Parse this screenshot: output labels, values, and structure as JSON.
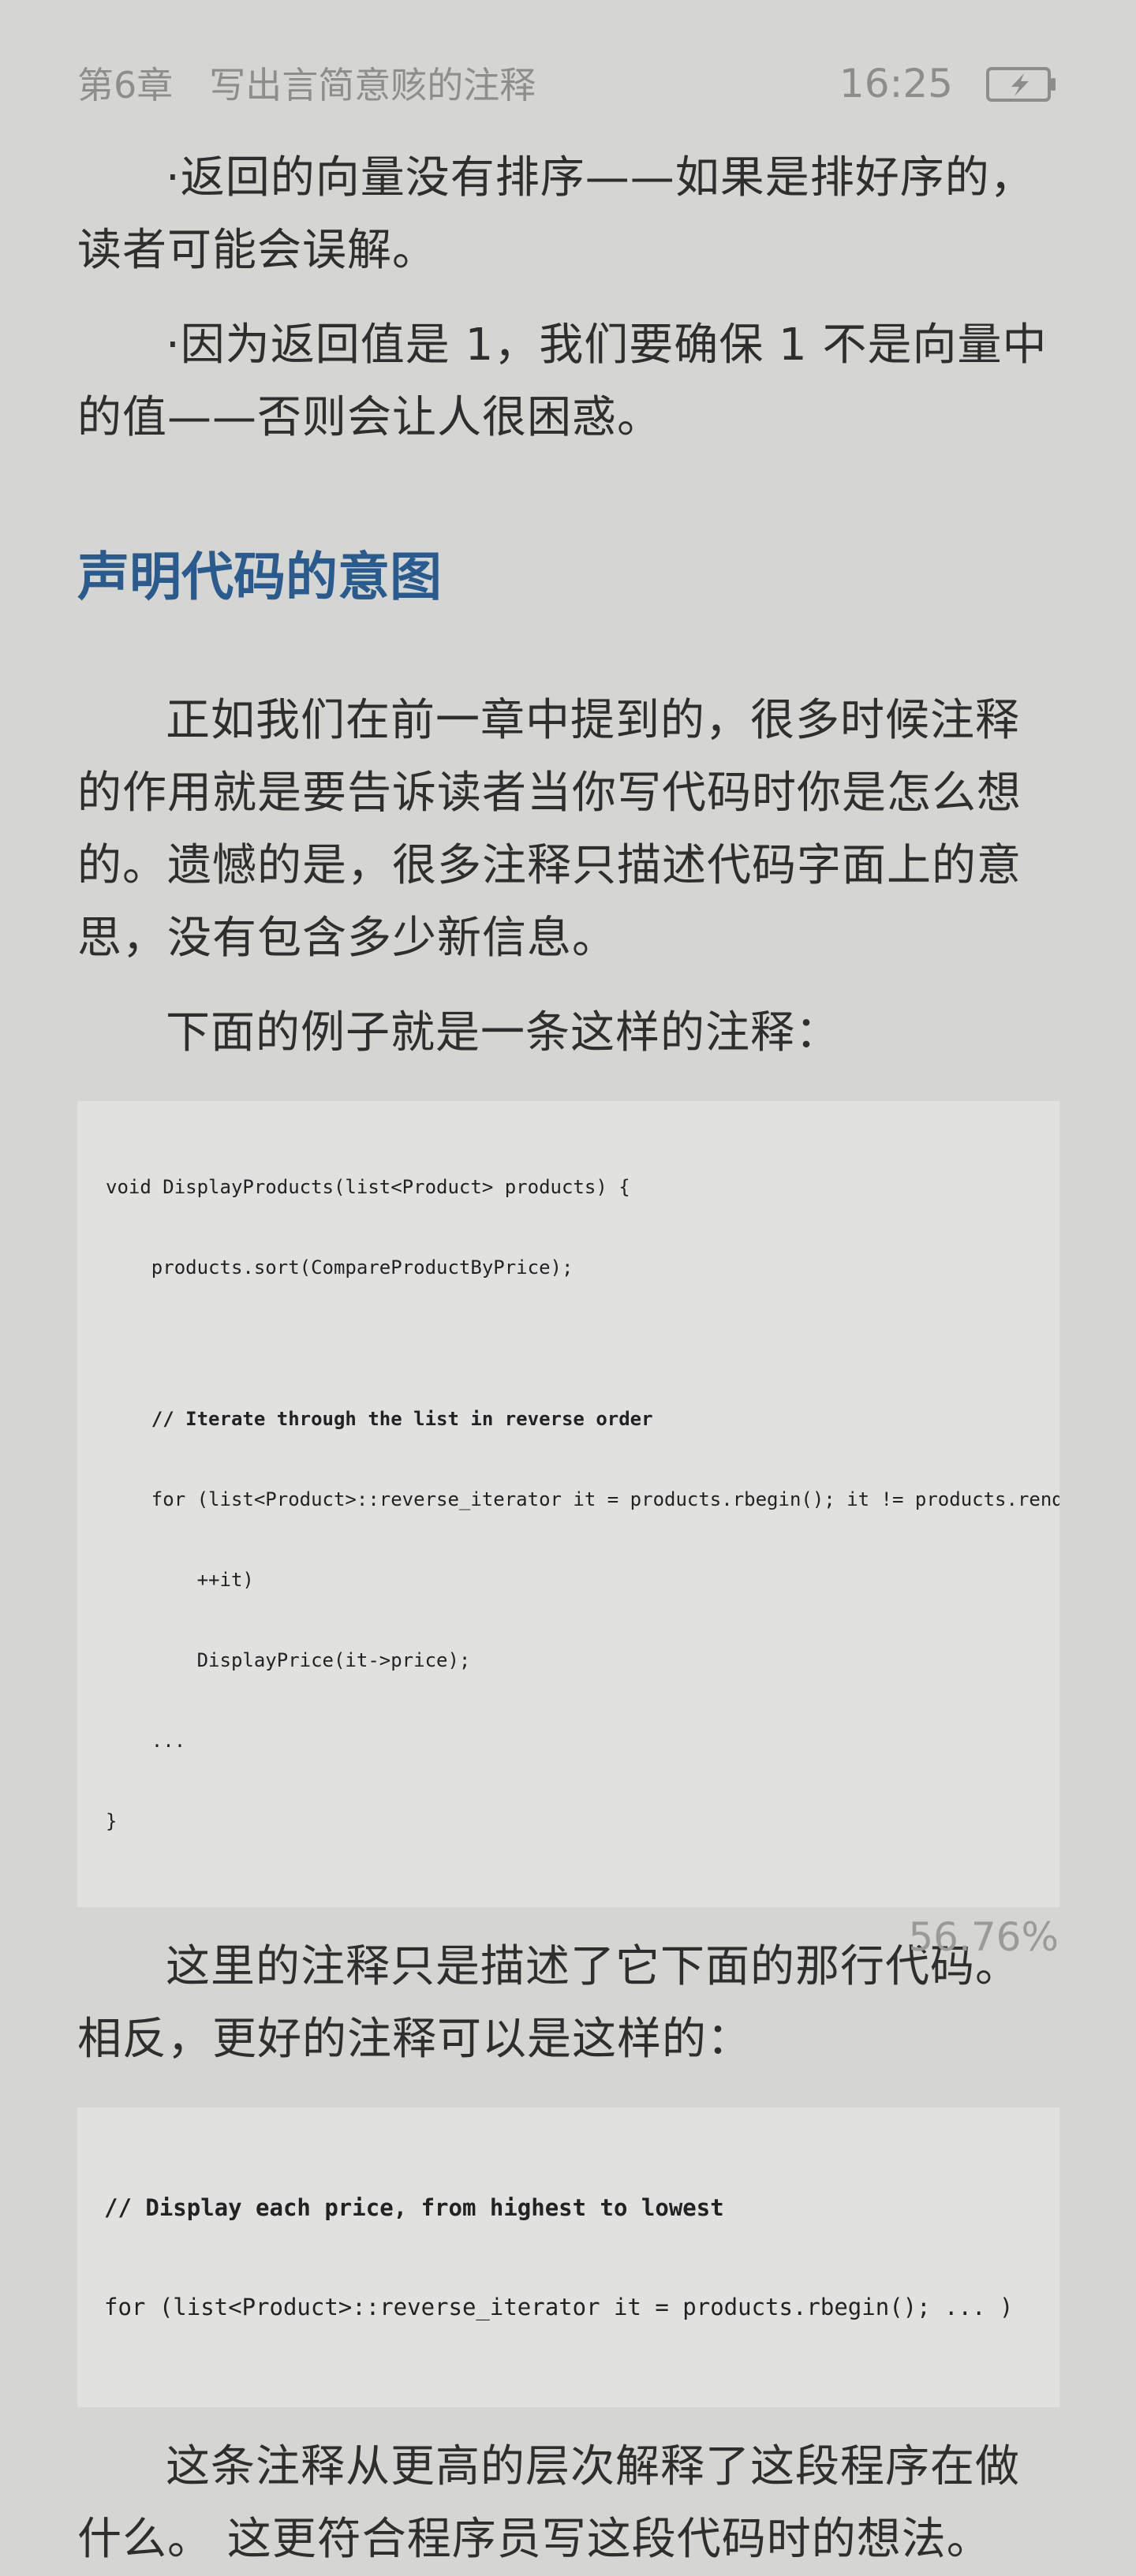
{
  "status_bar": {
    "chapter_title": "第6章　写出言简意赅的注释",
    "time": "16:25",
    "battery_icon": "battery-charging-icon"
  },
  "content": {
    "paragraphs_top": [
      "·返回的向量没有排序——如果是排好序的，读者可能会误解。",
      "·因为返回值是 1，我们要确保 1 不是向量中的值——否则会让人很困惑。"
    ],
    "heading": "声明代码的意图",
    "paragraphs_mid": [
      "正如我们在前一章中提到的，很多时候注释的作用就是要告诉读者当你写代码时你是怎么想的。遗憾的是，很多注释只描述代码字面上的意思，没有包含多少新信息。",
      "下面的例子就是一条这样的注释："
    ],
    "code_block_1": {
      "line1": "void DisplayProducts(list<Product> products) {",
      "line2": "    products.sort(CompareProductByPrice);",
      "line3": "    // Iterate through the list in reverse order",
      "line4": "    for (list<Product>::reverse_iterator it = products.rbegin(); it != products.rend();",
      "line5": "        ++it)",
      "line6": "        DisplayPrice(it->price);",
      "line7": "    ...",
      "line8": "}"
    },
    "paragraph_after_code1": "这里的注释只是描述了它下面的那行代码。相反，更好的注释可以是这样的：",
    "code_block_2": {
      "line1": "// Display each price, from highest to lowest",
      "line2": "for (list<Product>::reverse_iterator it = products.rbegin(); ... )"
    },
    "paragraph_final": "这条注释从更高的层次解释了这段程序在做什么。 这更符合程序员写这段代码时的想法。"
  },
  "footer": {
    "progress": "56.76%"
  },
  "colors": {
    "background": "#d5d6d2",
    "heading": "#2a5b8e",
    "status_text": "#8d8e8b",
    "code_bg": "#e1e2e0"
  }
}
